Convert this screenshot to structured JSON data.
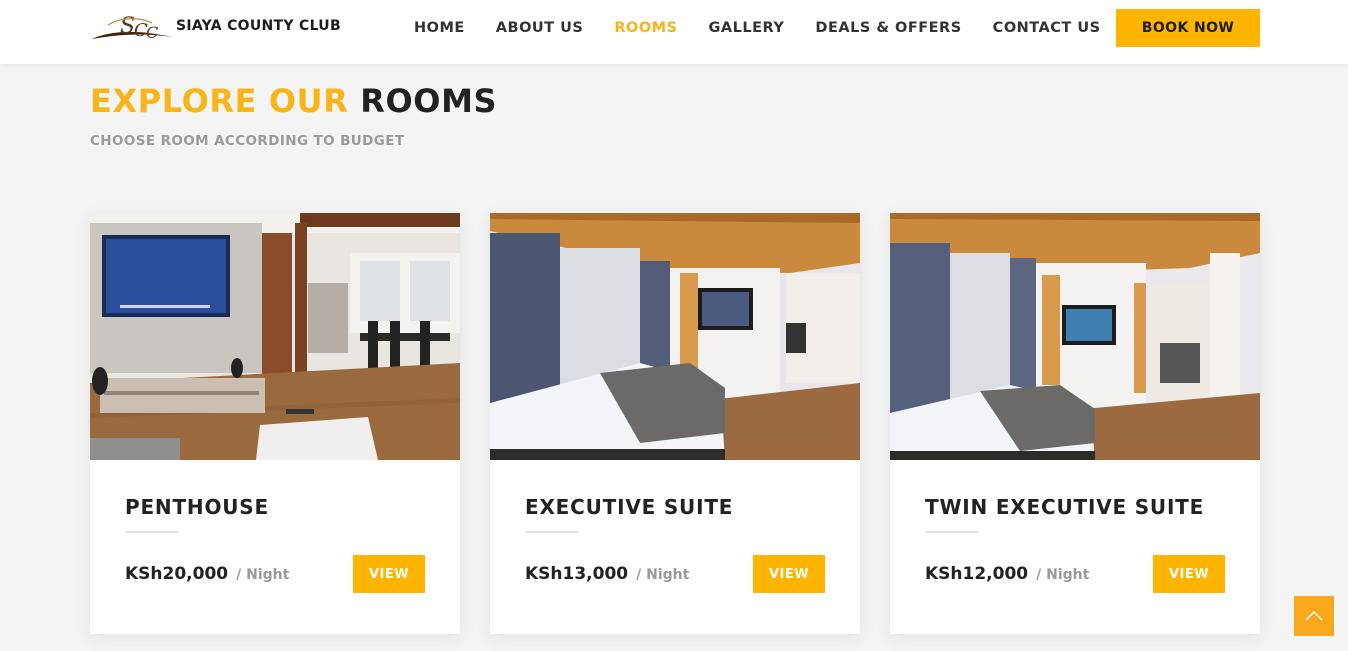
{
  "brand": {
    "name": "SIAYA COUNTY CLUB",
    "logo_initials": "SCC"
  },
  "nav": [
    {
      "label": "HOME",
      "active": false
    },
    {
      "label": "ABOUT US",
      "active": false
    },
    {
      "label": "ROOMS",
      "active": true
    },
    {
      "label": "GALLERY",
      "active": false
    },
    {
      "label": "DEALS & OFFERS",
      "active": false
    },
    {
      "label": "CONTACT US",
      "active": false
    }
  ],
  "book_button": "BOOK NOW",
  "heading": {
    "highlight": "EXPLORE OUR",
    "rest": "ROOMS",
    "subtitle": "CHOOSE ROOM ACCORDING TO BUDGET"
  },
  "rooms": [
    {
      "name": "PENTHOUSE",
      "price": "KSh20,000",
      "per": "/ Night",
      "button": "VIEW",
      "image": "penthouse-living-room-photo"
    },
    {
      "name": "EXECUTIVE SUITE",
      "price": "KSh13,000",
      "per": "/ Night",
      "button": "VIEW",
      "image": "executive-suite-bedroom-photo"
    },
    {
      "name": "TWIN EXECUTIVE SUITE",
      "price": "KSh12,000",
      "per": "/ Night",
      "button": "VIEW",
      "image": "twin-executive-suite-bedroom-photo"
    }
  ],
  "colors": {
    "accent": "#ffb500",
    "text": "#222222",
    "muted": "#9a9a9a",
    "background": "#f4f4f4"
  },
  "icons": {
    "scroll_top": "chevron-up-icon"
  }
}
